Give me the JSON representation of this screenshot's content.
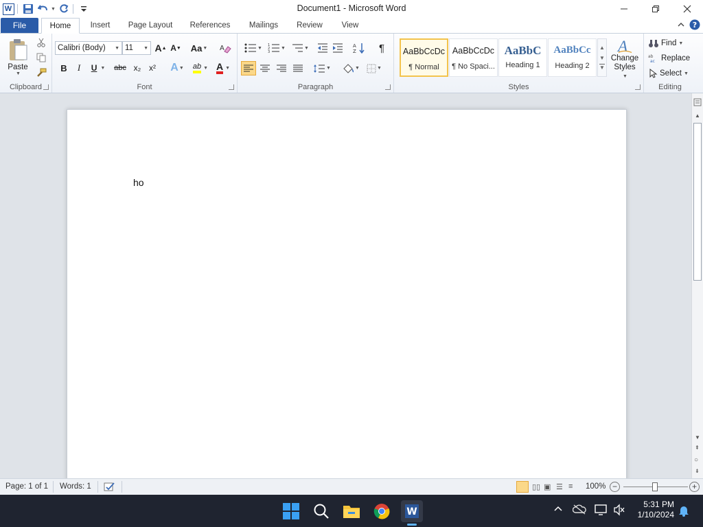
{
  "window": {
    "title": "Document1  -  Microsoft Word"
  },
  "qat": {
    "app_icon_letter": "W"
  },
  "tabs": {
    "file": "File",
    "items": [
      "Home",
      "Insert",
      "Page Layout",
      "References",
      "Mailings",
      "Review",
      "View"
    ]
  },
  "ribbon": {
    "clipboard": {
      "label": "Clipboard",
      "paste": "Paste"
    },
    "font": {
      "label": "Font",
      "family": "Calibri (Body)",
      "size": "11",
      "grow": "A",
      "shrink": "A",
      "case": "Aa",
      "bold": "B",
      "italic": "I",
      "underline": "U",
      "strike": "abc",
      "sub": "x₂",
      "sup": "x²",
      "effects": "A",
      "highlight": "ab",
      "color": "A"
    },
    "paragraph": {
      "label": "Paragraph",
      "pilcrow": "¶"
    },
    "styles": {
      "label": "Styles",
      "items": [
        {
          "preview": "AaBbCcDc",
          "name": "¶ Normal"
        },
        {
          "preview": "AaBbCcDc",
          "name": "¶ No Spaci..."
        },
        {
          "preview": "AaBbC",
          "name": "Heading 1"
        },
        {
          "preview": "AaBbCc",
          "name": "Heading 2"
        }
      ],
      "change_styles": "Change Styles"
    },
    "editing": {
      "label": "Editing",
      "find": "Find",
      "replace": "Replace",
      "select": "Select"
    }
  },
  "document": {
    "text": "ho"
  },
  "status": {
    "page": "Page: 1 of 1",
    "words": "Words: 1",
    "zoom": "100%"
  },
  "taskbar": {
    "time": "5:31 PM",
    "date": "1/10/2024"
  },
  "colors": {
    "file_tab": "#2a5ba8",
    "accent": "#f3c34c",
    "taskbar": "#1f2430"
  }
}
